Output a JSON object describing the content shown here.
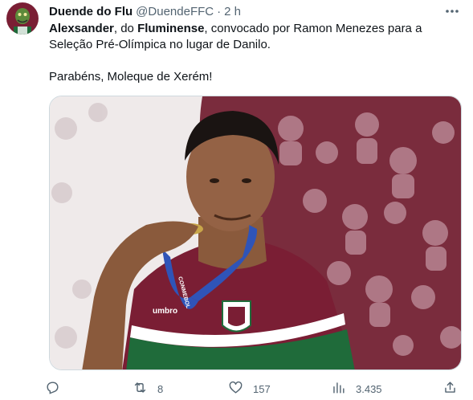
{
  "tweet": {
    "display_name": "Duende do Flu",
    "handle": "@DuendeFFC",
    "separator": "·",
    "time": "2 h",
    "text": {
      "line1_bold1": "Alexsander",
      "line1_mid": ", do ",
      "line1_bold2": "Fluminense",
      "line1_rest": ", convocado por Ramon Menezes para a",
      "line2": "Seleção Pré-Olímpica no lugar de Danilo.",
      "line3": "Parabéns, Moleque de Xerém!"
    },
    "media": {
      "jersey_brand": "umbro",
      "lanyard_text": "CONMEBOL"
    },
    "actions": {
      "replies": "",
      "retweets": "8",
      "likes": "157",
      "views": "3.435"
    }
  },
  "colors": {
    "maroon": "#7a1e34",
    "green": "#1f6b3a",
    "secondary_text": "#536471"
  },
  "icons": [
    "more-icon",
    "reply-icon",
    "retweet-icon",
    "like-icon",
    "views-icon",
    "share-icon"
  ]
}
